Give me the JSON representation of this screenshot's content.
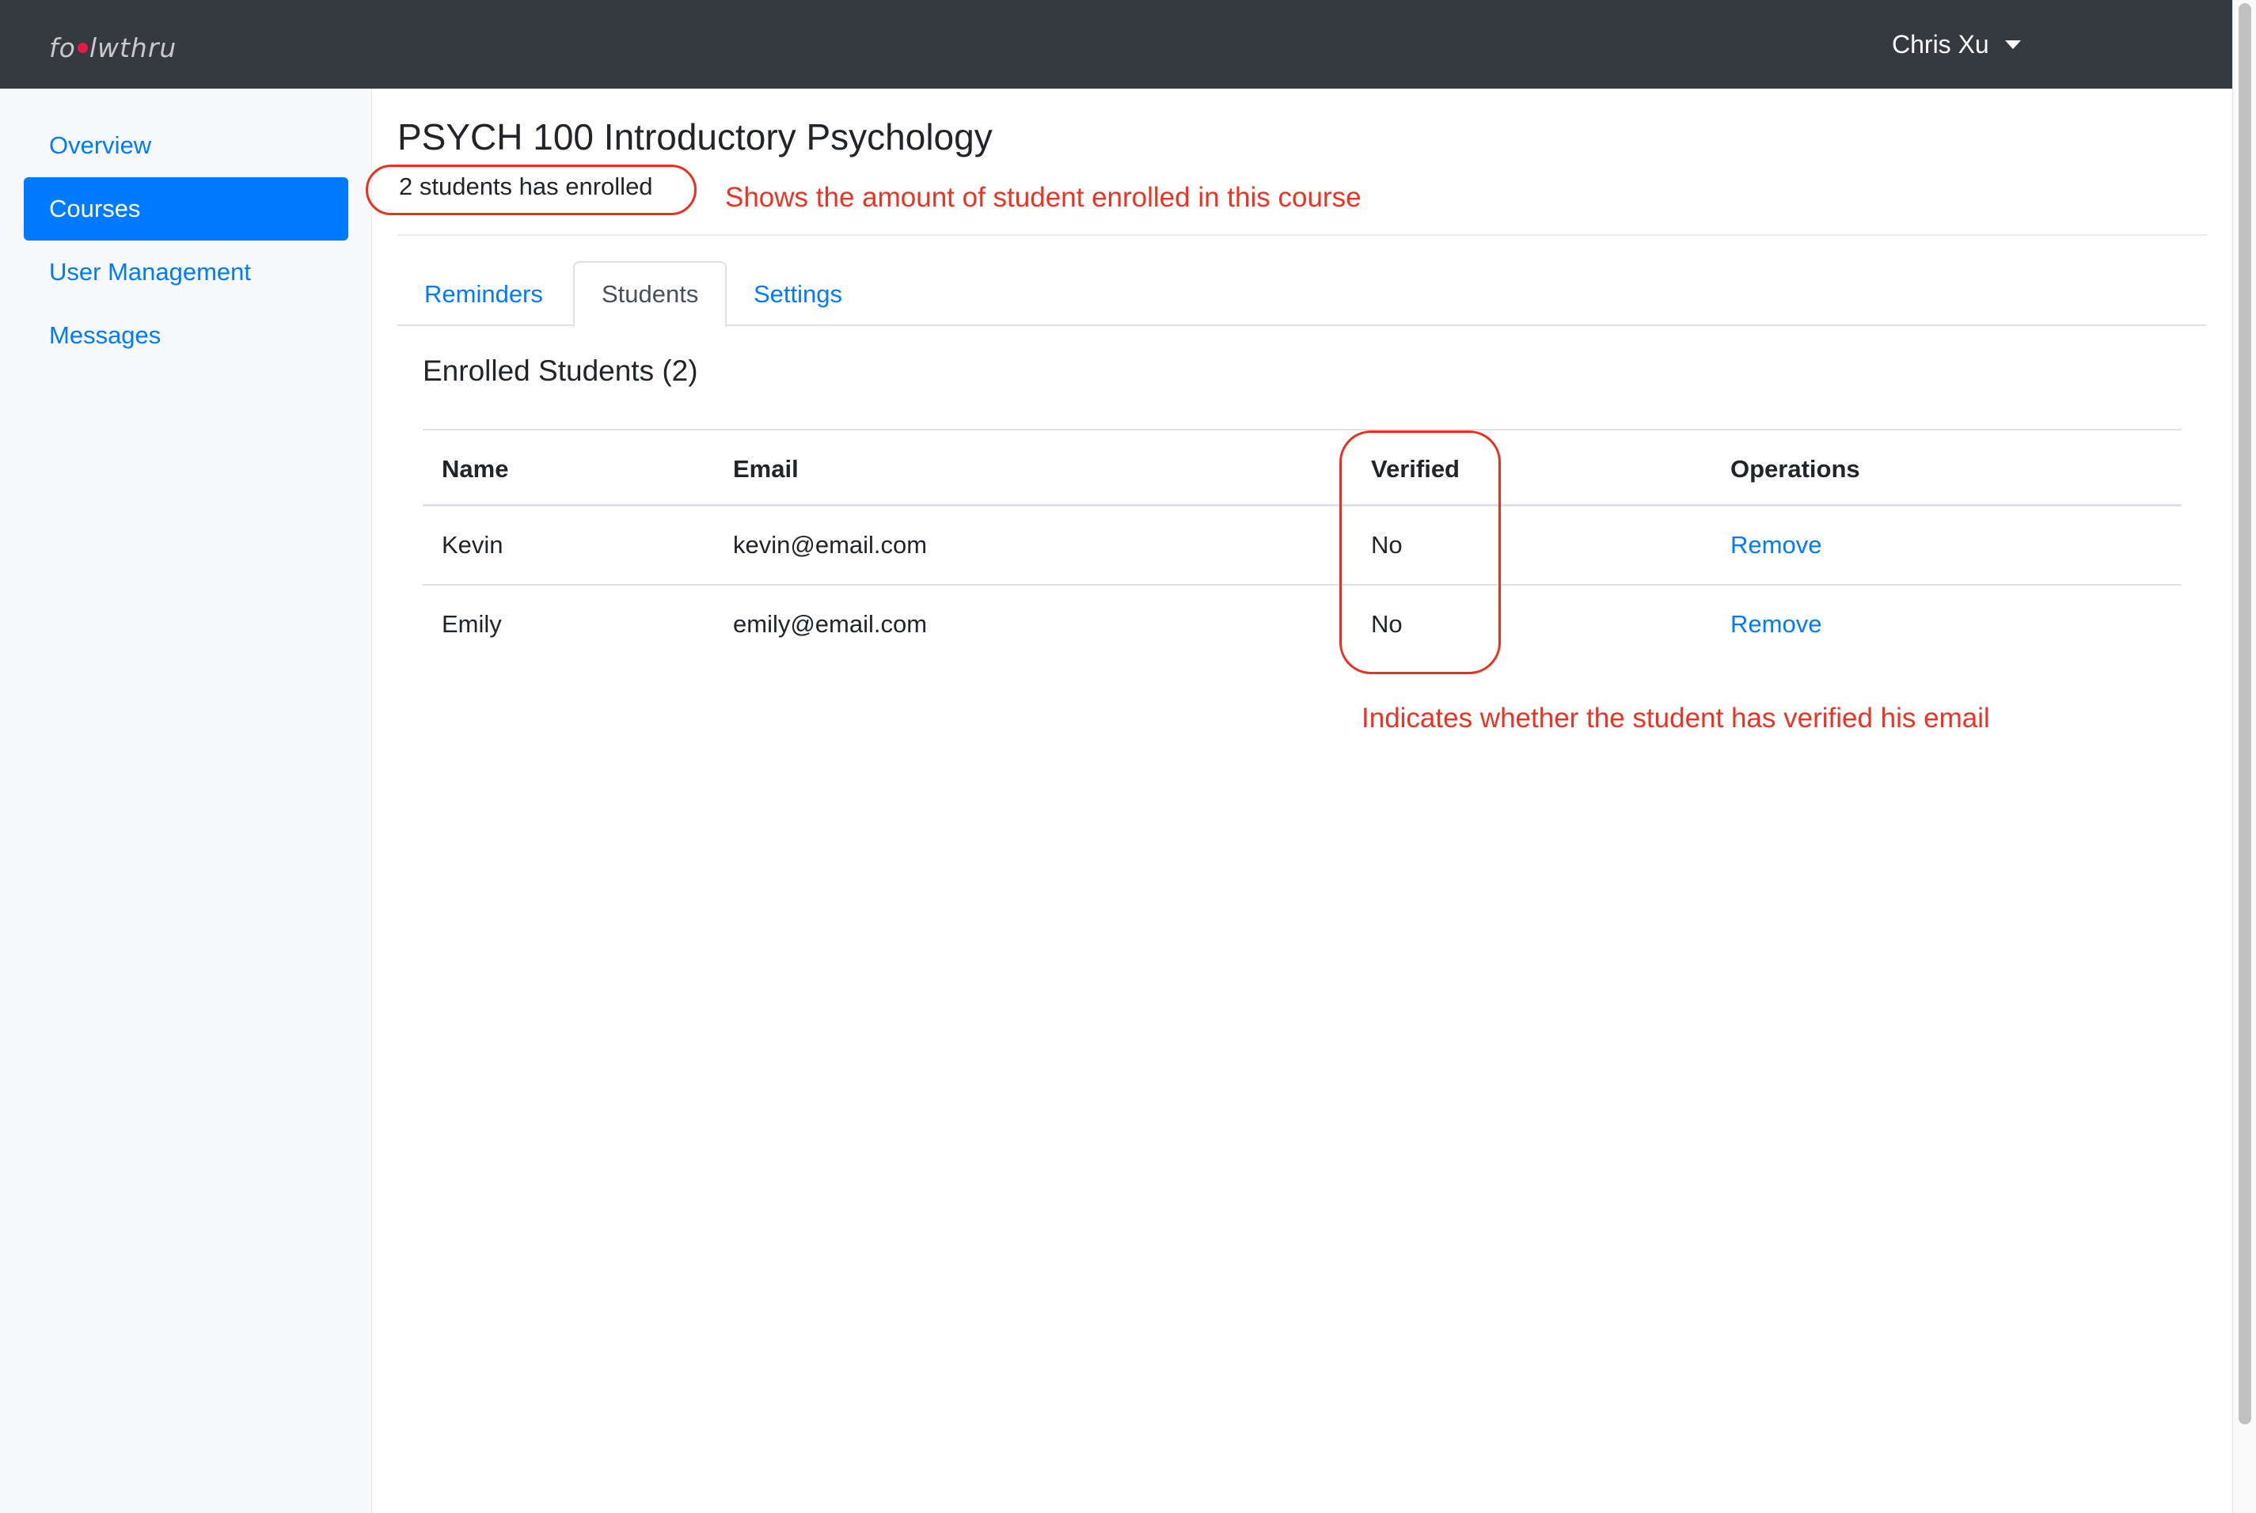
{
  "app": {
    "logo_text": "follwthru",
    "user_name": "Chris Xu"
  },
  "sidebar": {
    "items": [
      {
        "label": "Overview",
        "active": false
      },
      {
        "label": "Courses",
        "active": true
      },
      {
        "label": "User Management",
        "active": false
      },
      {
        "label": "Messages",
        "active": false
      }
    ]
  },
  "course": {
    "title": "PSYCH 100 Introductory Psychology",
    "enrollment_text": "2 students has enrolled"
  },
  "tabs": [
    {
      "label": "Reminders",
      "active": false
    },
    {
      "label": "Students",
      "active": true
    },
    {
      "label": "Settings",
      "active": false
    }
  ],
  "students_section": {
    "title": "Enrolled Students (2)",
    "columns": [
      "Name",
      "Email",
      "Verified",
      "Operations"
    ],
    "rows": [
      {
        "name": "Kevin",
        "email": "kevin@email.com",
        "verified": "No",
        "operation": "Remove"
      },
      {
        "name": "Emily",
        "email": "emily@email.com",
        "verified": "No",
        "operation": "Remove"
      }
    ]
  },
  "annotations": {
    "enrollment_note": "Shows the amount of student enrolled in this course",
    "verified_note": "Indicates whether the student has verified his email"
  },
  "colors": {
    "navbar": "#343a40",
    "primary": "#007bff",
    "annotation": "#ea3323",
    "sidebar_bg": "#f8f9fa"
  }
}
